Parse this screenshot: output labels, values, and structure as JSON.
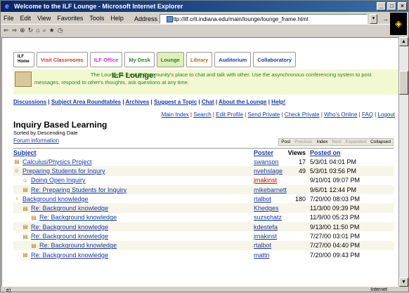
{
  "window": {
    "title": "Welcome to the ILF Lounge - Microsoft Internet Explorer",
    "menu": [
      "File",
      "Edit",
      "View",
      "Favorites",
      "Tools",
      "Help"
    ],
    "address_label": "Address",
    "address_url": "http://ilf.crlt.indiana.edu/main/lounge/lounge_frame.html",
    "go_label": "Go",
    "status_zone": "Internet",
    "status_left": "e)"
  },
  "tabs": [
    {
      "label": "ILF Home",
      "color": "#000000"
    },
    {
      "label": "Visit Classrooms",
      "color": "#cc3333"
    },
    {
      "label": "ILF Office",
      "color": "#cc33cc"
    },
    {
      "label": "My Desk",
      "color": "#2e7d2e"
    },
    {
      "label": "Lounge",
      "color": "#2e7d2e"
    },
    {
      "label": "Library",
      "color": "#cc6600"
    },
    {
      "label": "Auditorium",
      "color": "#1a3aa0"
    },
    {
      "label": "Collaboratory",
      "color": "#1a3aa0"
    }
  ],
  "hero": {
    "title": "ILF Lounge:",
    "desc": "The Lounge is the ILF Community's place to chat and talk with other. Use the asynchronous conferencing system to post messages, respond to other's thoughts, ask questions at any time."
  },
  "navlinks": [
    "Discussions",
    "Subject Area Roundtables",
    "Archives",
    "Suggest a Topic",
    "Chat",
    "About the Lounge",
    "Help!"
  ],
  "mainlinks": [
    "Main Index",
    "Search",
    "Edit Profile",
    "Send Private",
    "Check Private",
    "Who's Online",
    "FAQ",
    "Logout"
  ],
  "page": {
    "heading": "Inquiry Based Learning",
    "sort": "Sorted by Descending Date",
    "forum_info": "Forum information"
  },
  "actions": [
    {
      "label": "Post",
      "dim": false
    },
    {
      "label": "Previous",
      "dim": true
    },
    {
      "label": "Index",
      "dim": false
    },
    {
      "label": "Next",
      "dim": true
    },
    {
      "label": "Expanded",
      "dim": true
    },
    {
      "label": "Collapsed",
      "dim": false
    }
  ],
  "table": {
    "headers": [
      "Subject",
      "Poster",
      "Views",
      "Posted on"
    ],
    "rows": [
      {
        "subject": "Calculus/Physics Project",
        "poster": "swanson",
        "views": "17",
        "date": "5/3/01 04:01 PM",
        "indent": 0,
        "icon": "msg-icon",
        "red": false
      },
      {
        "subject": "Preparing Students for Inqury",
        "poster": "nvehslage",
        "views": "49",
        "date": "5/3/01 03:56 PM",
        "indent": 0,
        "icon": "smiley-icon",
        "red": false
      },
      {
        "subject": "Doing Open Inquiry",
        "poster": "jmakinst",
        "views": "",
        "date": "9/10/01 09:07 PM",
        "indent": 1,
        "icon": "smiley-icon",
        "red": true
      },
      {
        "subject": "Re: Preparing Students for Inquiry",
        "poster": "mikebarnett",
        "views": "",
        "date": "9/6/01 12:44 PM",
        "indent": 1,
        "icon": "msg-icon",
        "red": false
      },
      {
        "subject": "Background knowledge",
        "poster": "rtalbot",
        "views": "180",
        "date": "7/20/00 08:03 PM",
        "indent": 0,
        "icon": "bulb-icon",
        "red": false
      },
      {
        "subject": "Re: Background knowledge",
        "poster": "Khedges",
        "views": "",
        "date": "11/3/00 09:39 PM",
        "indent": 1,
        "icon": "msg-icon",
        "red": false
      },
      {
        "subject": "Re: Background knowledge",
        "poster": "suzschatz",
        "views": "",
        "date": "11/9/00 05:23 PM",
        "indent": 2,
        "icon": "msg-icon",
        "red": false
      },
      {
        "subject": "Re: Background knowledge",
        "poster": "kdestefa",
        "views": "",
        "date": "9/13/00 11:50 PM",
        "indent": 1,
        "icon": "msg-icon",
        "red": false
      },
      {
        "subject": "Re: Background knowledge",
        "poster": "jmakinst",
        "views": "",
        "date": "7/27/00 03:01 PM",
        "indent": 1,
        "icon": "msg-icon",
        "red": false
      },
      {
        "subject": "Re: Background knowledge",
        "poster": "rtalbot",
        "views": "",
        "date": "7/27/00 04:40 PM",
        "indent": 2,
        "icon": "msg-icon",
        "red": false
      },
      {
        "subject": "Re: Background knowledge",
        "poster": "mattn",
        "views": "",
        "date": "7/20/00 09:43 PM",
        "indent": 1,
        "icon": "msg-icon",
        "red": false
      }
    ]
  }
}
